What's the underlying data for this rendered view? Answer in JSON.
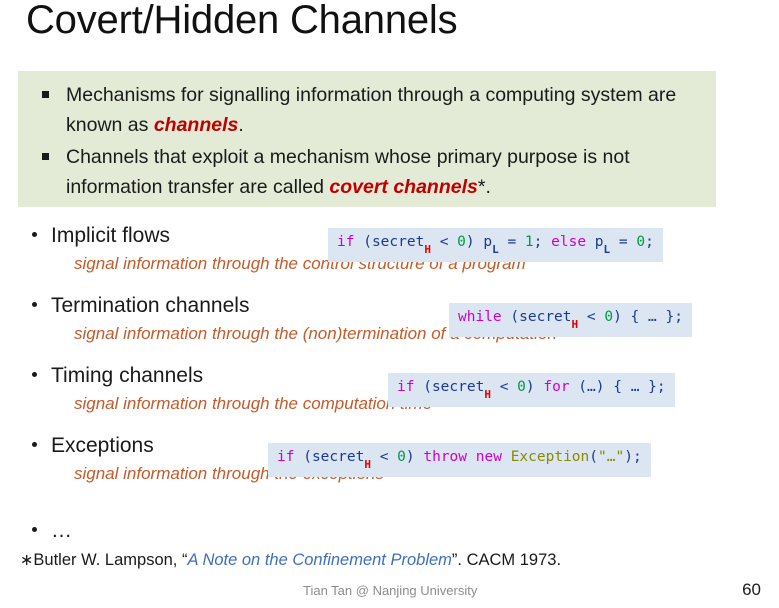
{
  "slide": {
    "title": "Covert/Hidden Channels",
    "page_number": "60",
    "credit": "Tian Tan @ Nanjing University",
    "accent_green_bg": "#e3ebd7",
    "accent_code_bg": "#dce6f2",
    "accent_red": "#c00000",
    "accent_orange": "#c55a2a",
    "accent_link_blue": "#3d6fbf"
  },
  "callout": {
    "items": [
      {
        "prefix": "Mechanisms for signalling information through a computing system are known as ",
        "emphasis": "channels",
        "suffix": ".",
        "emphasis_suffix": ""
      },
      {
        "prefix": "Channels that exploit a mechanism whose primary purpose is not information transfer are called ",
        "emphasis": "covert channels",
        "suffix": ".",
        "emphasis_suffix": "*"
      }
    ]
  },
  "topics": [
    {
      "label": "Implicit flows",
      "description": "signal information through the control structure of a program",
      "code": {
        "tokens": [
          {
            "t": "if",
            "c": "kw"
          },
          {
            "t": " ",
            "c": "plain"
          },
          {
            "t": "(",
            "c": "punc"
          },
          {
            "t": "secret",
            "c": "id"
          },
          {
            "t": "H",
            "c": "sub-h"
          },
          {
            "t": " ",
            "c": "plain"
          },
          {
            "t": "<",
            "c": "op"
          },
          {
            "t": " ",
            "c": "plain"
          },
          {
            "t": "0",
            "c": "num"
          },
          {
            "t": ")",
            "c": "punc"
          },
          {
            "t": " ",
            "c": "plain"
          },
          {
            "t": "p",
            "c": "id"
          },
          {
            "t": "L",
            "c": "sub-l"
          },
          {
            "t": " ",
            "c": "plain"
          },
          {
            "t": "=",
            "c": "op"
          },
          {
            "t": " ",
            "c": "plain"
          },
          {
            "t": "1",
            "c": "num"
          },
          {
            "t": ";",
            "c": "punc"
          },
          {
            "t": " ",
            "c": "plain"
          },
          {
            "t": "else",
            "c": "kw"
          },
          {
            "t": " ",
            "c": "plain"
          },
          {
            "t": "p",
            "c": "id"
          },
          {
            "t": "L",
            "c": "sub-l"
          },
          {
            "t": " ",
            "c": "plain"
          },
          {
            "t": "=",
            "c": "op"
          },
          {
            "t": " ",
            "c": "plain"
          },
          {
            "t": "0",
            "c": "num"
          },
          {
            "t": ";",
            "c": "punc"
          }
        ],
        "plain": "if (secretH < 0) pL = 1; else pL = 0;"
      }
    },
    {
      "label": "Termination channels",
      "description": "signal information through the (non)termination of a computation",
      "code": {
        "tokens": [
          {
            "t": "while",
            "c": "kw"
          },
          {
            "t": " ",
            "c": "plain"
          },
          {
            "t": "(",
            "c": "punc"
          },
          {
            "t": "secret",
            "c": "id"
          },
          {
            "t": "H",
            "c": "sub-h"
          },
          {
            "t": " ",
            "c": "plain"
          },
          {
            "t": "<",
            "c": "op"
          },
          {
            "t": " ",
            "c": "plain"
          },
          {
            "t": "0",
            "c": "num"
          },
          {
            "t": ")",
            "c": "punc"
          },
          {
            "t": " ",
            "c": "plain"
          },
          {
            "t": "{",
            "c": "punc"
          },
          {
            "t": " … ",
            "c": "plain"
          },
          {
            "t": "}",
            "c": "punc"
          },
          {
            "t": ";",
            "c": "punc"
          }
        ],
        "plain": "while (secretH < 0) { … };"
      }
    },
    {
      "label": "Timing channels",
      "description": "signal information through the computation time",
      "code": {
        "tokens": [
          {
            "t": "if",
            "c": "kw"
          },
          {
            "t": " ",
            "c": "plain"
          },
          {
            "t": "(",
            "c": "punc"
          },
          {
            "t": "secret",
            "c": "id"
          },
          {
            "t": "H",
            "c": "sub-h"
          },
          {
            "t": " ",
            "c": "plain"
          },
          {
            "t": "<",
            "c": "op"
          },
          {
            "t": " ",
            "c": "plain"
          },
          {
            "t": "0",
            "c": "num"
          },
          {
            "t": ")",
            "c": "punc"
          },
          {
            "t": " ",
            "c": "plain"
          },
          {
            "t": "for",
            "c": "kw"
          },
          {
            "t": " ",
            "c": "plain"
          },
          {
            "t": "(…)",
            "c": "punc"
          },
          {
            "t": " ",
            "c": "plain"
          },
          {
            "t": "{",
            "c": "punc"
          },
          {
            "t": " … ",
            "c": "plain"
          },
          {
            "t": "}",
            "c": "punc"
          },
          {
            "t": ";",
            "c": "punc"
          }
        ],
        "plain": "if (secretH < 0) for (…) { … };"
      }
    },
    {
      "label": "Exceptions",
      "description": "signal information through the exceptions",
      "code": {
        "tokens": [
          {
            "t": "if",
            "c": "kw"
          },
          {
            "t": " ",
            "c": "plain"
          },
          {
            "t": "(",
            "c": "punc"
          },
          {
            "t": "secret",
            "c": "id"
          },
          {
            "t": "H",
            "c": "sub-h"
          },
          {
            "t": " ",
            "c": "plain"
          },
          {
            "t": "<",
            "c": "op"
          },
          {
            "t": " ",
            "c": "plain"
          },
          {
            "t": "0",
            "c": "num"
          },
          {
            "t": ")",
            "c": "punc"
          },
          {
            "t": " ",
            "c": "plain"
          },
          {
            "t": "throw",
            "c": "kw"
          },
          {
            "t": " ",
            "c": "plain"
          },
          {
            "t": "new",
            "c": "kw"
          },
          {
            "t": " ",
            "c": "plain"
          },
          {
            "t": "Exception",
            "c": "type"
          },
          {
            "t": "(",
            "c": "punc"
          },
          {
            "t": "\"…\"",
            "c": "str"
          },
          {
            "t": ")",
            "c": "punc"
          },
          {
            "t": ";",
            "c": "punc"
          }
        ],
        "plain": "if (secretH < 0) throw new Exception(\"…\");"
      }
    }
  ],
  "ellipsis_item": "…",
  "footnote": {
    "marker": "∗",
    "before": "Butler W. Lampson, “",
    "link": "A Note on the Confinement Problem",
    "after": "”. CACM 1973."
  }
}
